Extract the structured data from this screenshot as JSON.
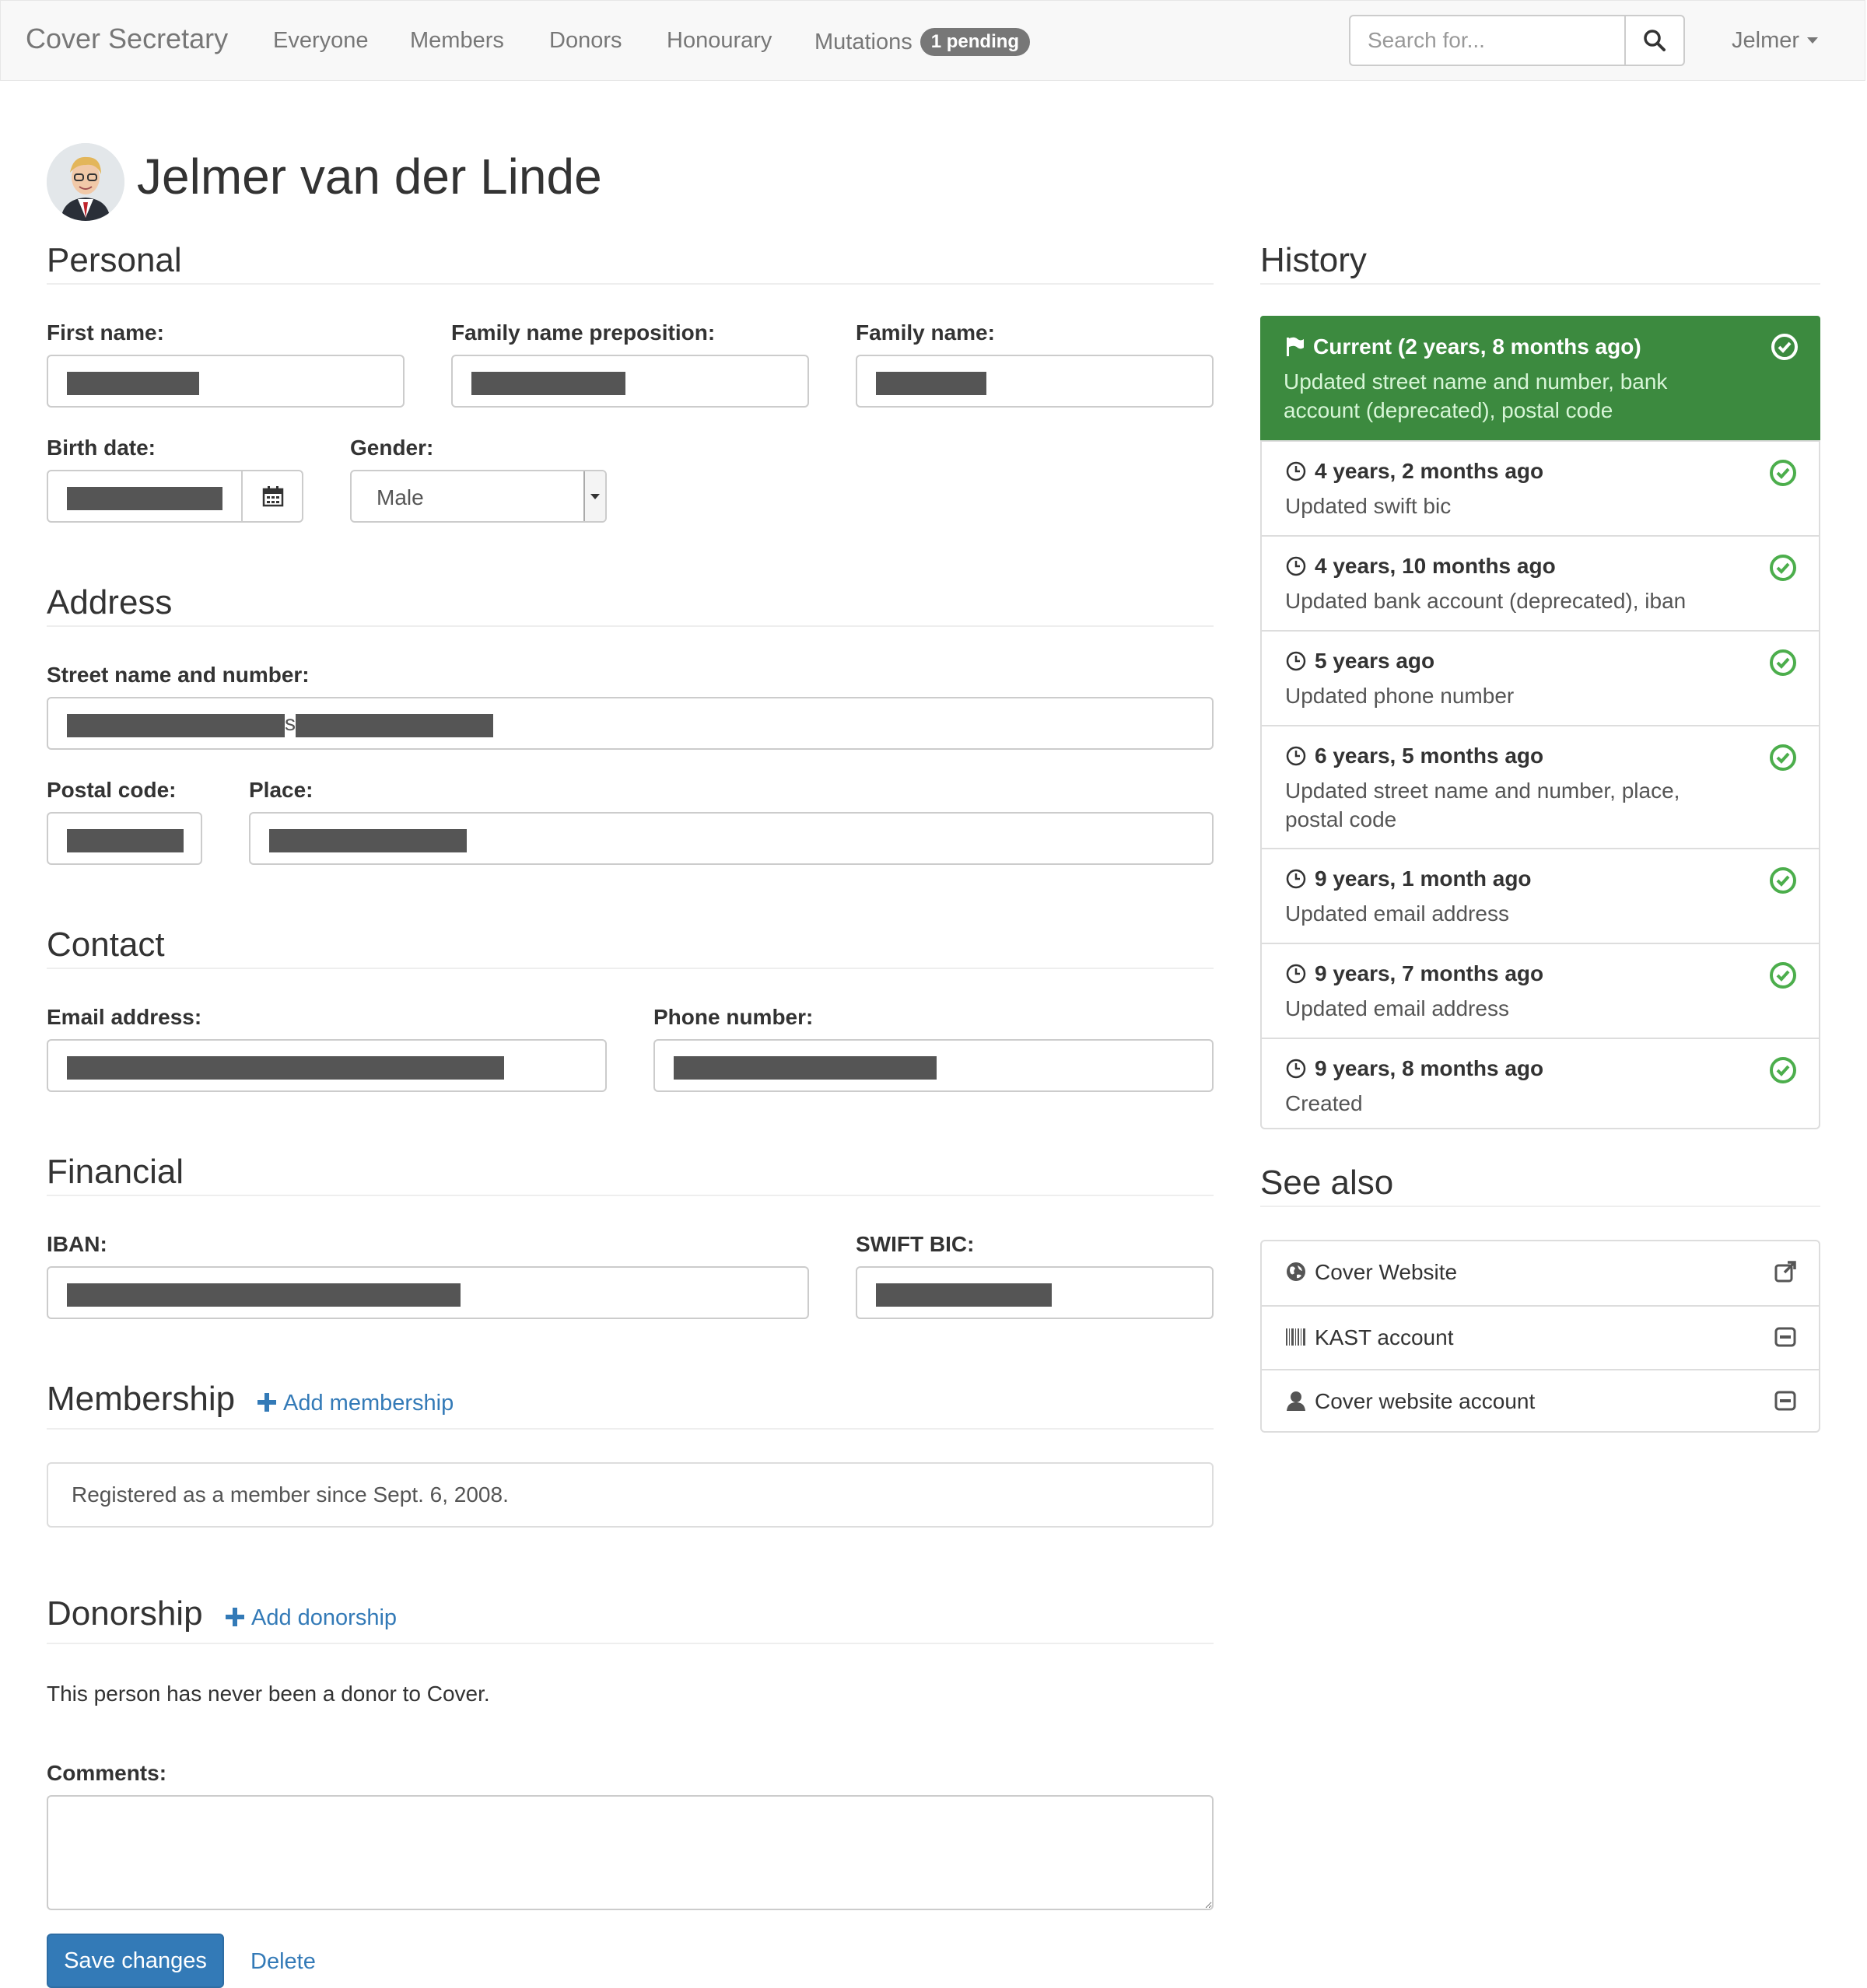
{
  "navbar": {
    "brand": "Cover Secretary",
    "items": [
      {
        "label": "Everyone"
      },
      {
        "label": "Members"
      },
      {
        "label": "Donors"
      },
      {
        "label": "Honourary"
      },
      {
        "label": "Mutations",
        "badge": "1 pending"
      }
    ],
    "search_placeholder": "Search for...",
    "user": "Jelmer"
  },
  "person": {
    "name": "Jelmer van der Linde"
  },
  "personal": {
    "title": "Personal",
    "first_name_label": "First name:",
    "preposition_label": "Family name preposition:",
    "family_name_label": "Family name:",
    "birth_date_label": "Birth date:",
    "gender_label": "Gender:",
    "gender_value": "Male"
  },
  "address": {
    "title": "Address",
    "street_label": "Street name and number:",
    "street_visible_char": "s",
    "postal_label": "Postal code:",
    "place_label": "Place:"
  },
  "contact": {
    "title": "Contact",
    "email_label": "Email address:",
    "phone_label": "Phone number:"
  },
  "financial": {
    "title": "Financial",
    "iban_label": "IBAN:",
    "bic_label": "SWIFT BIC:"
  },
  "membership": {
    "title": "Membership",
    "add_label": "Add membership",
    "text": "Registered as a member since Sept. 6, 2008."
  },
  "donorship": {
    "title": "Donorship",
    "add_label": "Add donorship",
    "text": "This person has never been a donor to Cover."
  },
  "comments": {
    "label": "Comments:"
  },
  "actions": {
    "save": "Save changes",
    "delete": "Delete"
  },
  "history": {
    "title": "History",
    "items": [
      {
        "time": "Current (2 years, 8 months ago)",
        "desc": "Updated street name and number, bank account (deprecated), postal code"
      },
      {
        "time": "4 years, 2 months ago",
        "desc": "Updated swift bic"
      },
      {
        "time": "4 years, 10 months ago",
        "desc": "Updated bank account (deprecated), iban"
      },
      {
        "time": "5 years ago",
        "desc": "Updated phone number"
      },
      {
        "time": "6 years, 5 months ago",
        "desc": "Updated street name and number, place, postal code"
      },
      {
        "time": "9 years, 1 month ago",
        "desc": "Updated email address"
      },
      {
        "time": "9 years, 7 months ago",
        "desc": "Updated email address"
      },
      {
        "time": "9 years, 8 months ago",
        "desc": "Created"
      }
    ]
  },
  "see_also": {
    "title": "See also",
    "items": [
      {
        "label": "Cover Website",
        "icon": "globe-icon",
        "action": "external-link-icon"
      },
      {
        "label": "KAST account",
        "icon": "barcode-icon",
        "action": "window-icon"
      },
      {
        "label": "Cover website account",
        "icon": "user-icon",
        "action": "window-icon"
      }
    ]
  },
  "colors": {
    "accent": "#337ab7",
    "success": "#3c8a3f",
    "check": "#4cae4c"
  }
}
